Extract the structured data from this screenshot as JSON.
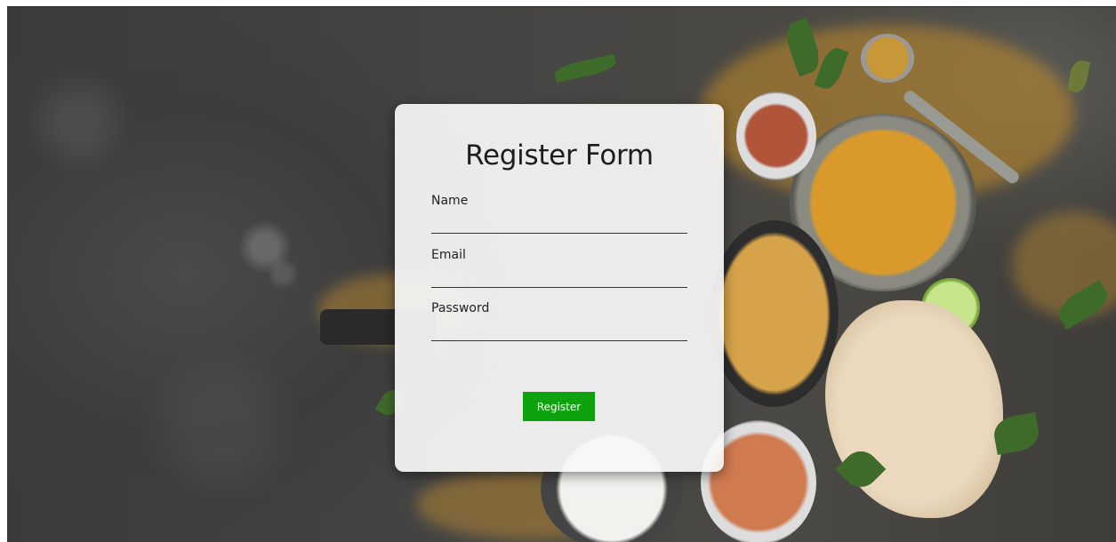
{
  "form": {
    "title": "Register Form",
    "fields": [
      {
        "label": "Name",
        "value": ""
      },
      {
        "label": "Email",
        "value": ""
      },
      {
        "label": "Password",
        "value": ""
      }
    ],
    "submit_label": "Register"
  },
  "colors": {
    "button": "#0ea30e",
    "card_background": "#f8f8f8",
    "page_background": "#3d3d3d"
  }
}
